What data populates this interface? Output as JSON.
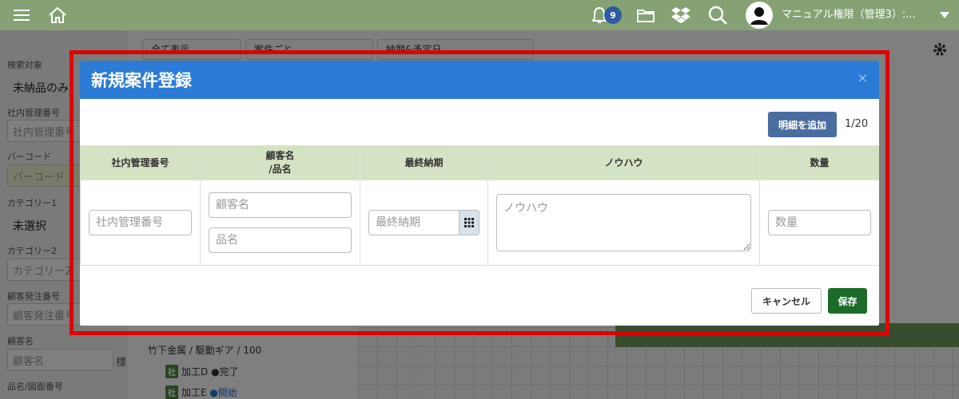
{
  "topbar": {
    "notification_count": "9",
    "user_name": "マニュアル権限（管理3）:...",
    "icons": [
      "menu-icon",
      "home-icon",
      "bell-icon",
      "folder-icon",
      "dropbox-icon",
      "search-icon",
      "user-avatar-icon",
      "caret-down-icon"
    ]
  },
  "background": {
    "side_labels": [
      "検索対象",
      "社内管理番号",
      "バーコード",
      "カテゴリー1",
      "カテゴリー2",
      "顧客発注番号",
      "顧客名",
      "品名/図面番号"
    ],
    "search_target_value": "未納品のみ",
    "mgmt_placeholder": "社内管理番号",
    "barcode_placeholder": "バーコード",
    "category1_value": "未選択",
    "category2_placeholder": "カテゴリー2",
    "order_no_placeholder": "顧客発注番号",
    "customer_placeholder": "顧客名",
    "honorific": "様",
    "tabs": [
      "全て表示",
      "案件ごと",
      "納期&予定日"
    ],
    "list_item_title": "竹下金属 / 駆動ギア / 100",
    "process_tag": "社",
    "process_1": "加工D",
    "process_1_status": "●完了",
    "process_2": "加工E",
    "process_2_status": "●開始"
  },
  "modal": {
    "title": "新規案件登録",
    "close_label": "×",
    "add_detail_button": "明細を追加",
    "page_count": "1/20",
    "columns": {
      "mgmt_no": "社内管理番号",
      "customer_line1": "顧客名",
      "customer_line2": "/品名",
      "due_date": "最終納期",
      "knowhow": "ノウハウ",
      "quantity": "数量"
    },
    "placeholders": {
      "mgmt_no": "社内管理番号",
      "customer": "顧客名",
      "product": "品名",
      "due_date": "最終納期",
      "knowhow": "ノウハウ",
      "quantity": "数量"
    },
    "cancel_button": "キャンセル",
    "save_button": "保存"
  },
  "colors": {
    "topbar": "#86a274",
    "modal_header": "#2b7bd6",
    "table_header": "#d4e3c3",
    "add_button": "#4a6da0",
    "save_button": "#1d6b2a",
    "highlight": "#e00000"
  }
}
